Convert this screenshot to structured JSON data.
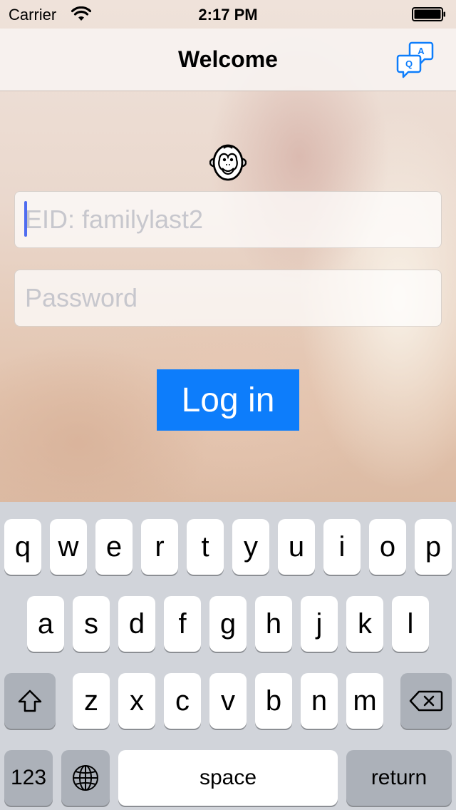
{
  "status_bar": {
    "carrier": "Carrier",
    "time": "2:17 PM",
    "wifi_icon": "wifi-icon",
    "battery_icon": "battery-icon"
  },
  "nav": {
    "title": "Welcome",
    "qa_icon": "qa-icon",
    "qa_letter_q": "Q",
    "qa_letter_a": "A",
    "accent_color": "#0d7dfb"
  },
  "logo_icon": "monkey-face-icon",
  "form": {
    "eid_value": "",
    "eid_placeholder": "EID: familylast2",
    "password_value": "",
    "password_placeholder": "Password",
    "login_label": "Log in"
  },
  "keyboard": {
    "row1": [
      "q",
      "w",
      "e",
      "r",
      "t",
      "y",
      "u",
      "i",
      "o",
      "p"
    ],
    "row2": [
      "a",
      "s",
      "d",
      "f",
      "g",
      "h",
      "j",
      "k",
      "l"
    ],
    "row3": [
      "z",
      "x",
      "c",
      "v",
      "b",
      "n",
      "m"
    ],
    "shift_icon": "shift-icon",
    "delete_icon": "delete-icon",
    "globe_icon": "globe-icon",
    "numbers_label": "123",
    "space_label": "space",
    "return_label": "return"
  }
}
